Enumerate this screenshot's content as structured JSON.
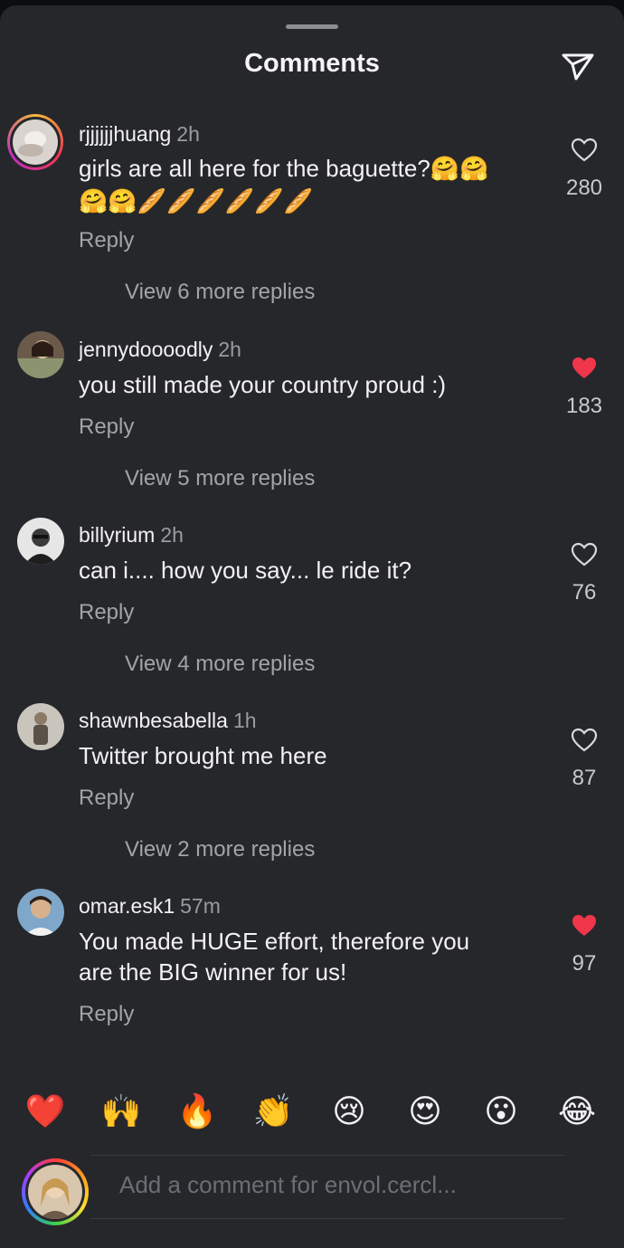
{
  "header": {
    "title": "Comments",
    "send_icon": "paper-plane-icon"
  },
  "comments": [
    {
      "username": "rjjjjjjhuang",
      "time": "2h",
      "text": "girls are all here for the baguette?🤗🤗",
      "text2": "🤗🤗🥖🥖🥖🥖🥖🥖",
      "reply_label": "Reply",
      "view_replies": "View 6 more replies",
      "likes": "280",
      "liked": false
    },
    {
      "username": "jennydoooodly",
      "time": "2h",
      "text": "you still made your country proud :)",
      "reply_label": "Reply",
      "view_replies": "View 5 more replies",
      "likes": "183",
      "liked": true
    },
    {
      "username": "billyrium",
      "time": "2h",
      "text": "can i.... how you say... le ride it?",
      "reply_label": "Reply",
      "view_replies": "View 4 more replies",
      "likes": "76",
      "liked": false
    },
    {
      "username": "shawnbesabella",
      "time": "1h",
      "text": "Twitter brought me here",
      "reply_label": "Reply",
      "view_replies": "View 2 more replies",
      "likes": "87",
      "liked": false
    },
    {
      "username": "omar.esk1",
      "time": "57m",
      "text": "You made HUGE effort, therefore you",
      "text2": "are the BIG winner for us!",
      "reply_label": "Reply",
      "likes": "97",
      "liked": true
    }
  ],
  "reactions": [
    "❤️",
    "🙌",
    "🔥",
    "👏",
    "😢",
    "😍",
    "😮",
    "😂"
  ],
  "composer": {
    "placeholder": "Add a comment for envol.cercl..."
  },
  "colors": {
    "liked_heart": "#f0364a",
    "background": "#26272b",
    "secondary_text": "#a3a4a8"
  }
}
